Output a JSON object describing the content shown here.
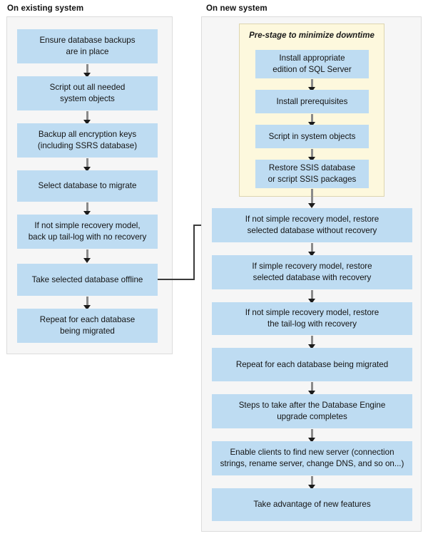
{
  "columns": [
    {
      "title": "On existing system"
    },
    {
      "title": "On new system"
    }
  ],
  "left_panel": {
    "nodes": [
      {
        "label": "Ensure database backups\nare in place"
      },
      {
        "label": "Script out all needed\nsystem objects"
      },
      {
        "label": "Backup all encryption keys\n(including SSRS database)"
      },
      {
        "label": "Select database to migrate"
      },
      {
        "label": "If not simple recovery model,\nback up tail-log with no recovery"
      },
      {
        "label": "Take selected database offline"
      },
      {
        "label": "Repeat for each database\nbeing migrated"
      }
    ]
  },
  "right_panel": {
    "prestage": {
      "title": "Pre-stage to minimize downtime",
      "nodes": [
        {
          "label": "Install appropriate\nedition of SQL Server"
        },
        {
          "label": "Install prerequisites"
        },
        {
          "label": "Script in system objects"
        },
        {
          "label": "Restore SSIS database\nor script SSIS packages"
        }
      ]
    },
    "nodes": [
      {
        "label": "If not simple recovery model, restore\nselected database without recovery"
      },
      {
        "label": "If simple recovery model, restore\nselected database with recovery"
      },
      {
        "label": "If not simple recovery model, restore\nthe tail-log with recovery"
      },
      {
        "label": "Repeat for each database being migrated"
      },
      {
        "label": "Steps to take after the Database Engine\nupgrade completes"
      },
      {
        "label": "Enable clients to find new server (connection\nstrings, rename server, change DNS, and so on...)"
      },
      {
        "label": "Take advantage of new features"
      }
    ]
  },
  "colors": {
    "node_fill": "#bedcf2",
    "panel_fill": "#f6f6f6",
    "panel_border": "#dcdcdc",
    "prestage_fill": "#fdf8dd",
    "prestage_border": "#ddd5b0",
    "arrow": "#1b1b1b",
    "connector": "#3a3a3a"
  }
}
